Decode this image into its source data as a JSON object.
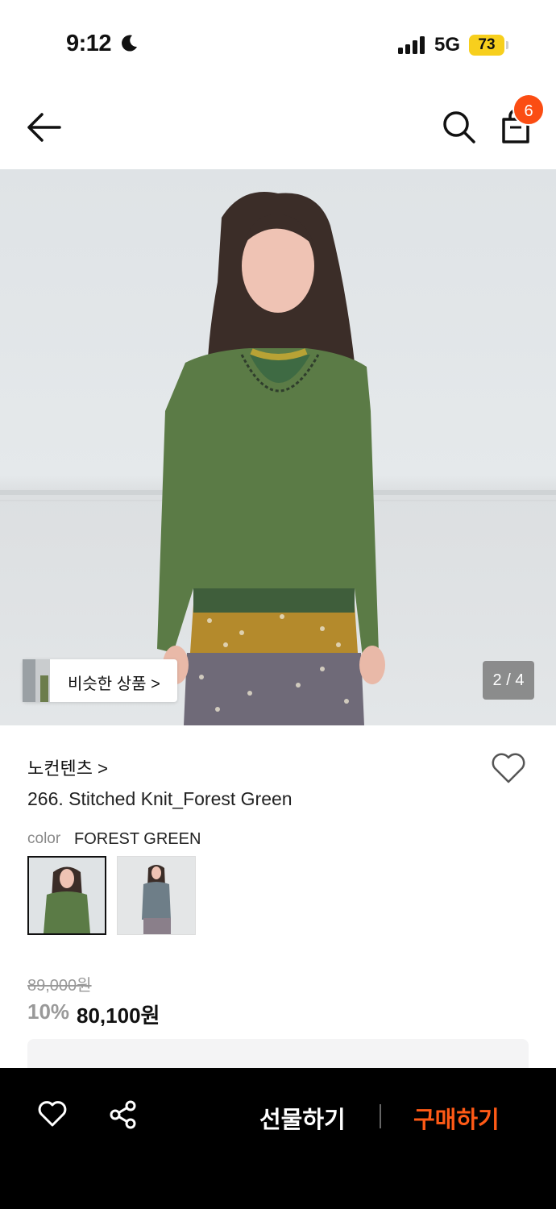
{
  "status_bar": {
    "time": "9:12",
    "network": "5G",
    "battery": "73"
  },
  "header": {
    "cart_count": "6"
  },
  "gallery": {
    "similar_label": "비슷한 상품 >",
    "page_indicator": "2 / 4"
  },
  "product": {
    "brand": "노컨텐츠 >",
    "title": "266. Stitched Knit_Forest Green",
    "color_key": "color",
    "color_value": "FOREST GREEN",
    "swatches": [
      "forest-green",
      "gray"
    ]
  },
  "price": {
    "original": "89,000원",
    "discount": "10%",
    "sale": "80,100원"
  },
  "bottom_bar": {
    "gift_label": "선물하기",
    "buy_label": "구매하기"
  },
  "colors": {
    "accent": "#fb4d13",
    "buy": "#ff5a16",
    "battery": "#f7cf1d",
    "bar_bg": "#000000"
  },
  "icons": [
    "back-arrow-icon",
    "search-icon",
    "shopping-bag-icon",
    "heart-icon",
    "share-icon",
    "moon-icon",
    "signal-icon"
  ]
}
